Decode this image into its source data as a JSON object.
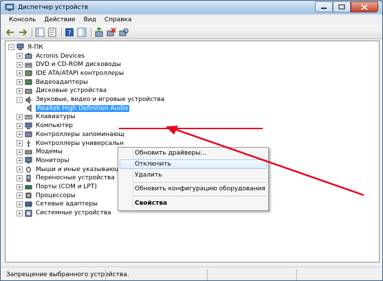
{
  "window": {
    "title": "Диспетчер устройств"
  },
  "menu": [
    "Консоль",
    "Действие",
    "Вид",
    "Справка"
  ],
  "toolbar_icons": [
    "back-icon",
    "forward-icon",
    "show-hide-tree-icon",
    "properties-icon",
    "help-icon",
    "action-pane-icon",
    "update-driver-icon",
    "uninstall-icon",
    "scan-hardware-icon"
  ],
  "tree": {
    "root": "Я-ПК",
    "items": [
      {
        "label": "Acronis Devices",
        "icon": "device-icon",
        "expander": "+"
      },
      {
        "label": "DVD и CD-ROM дисководы",
        "icon": "dvd-icon",
        "expander": "+"
      },
      {
        "label": "IDE ATA/ATAPI контроллеры",
        "icon": "ide-icon",
        "expander": "+"
      },
      {
        "label": "Видеоадаптеры",
        "icon": "display-icon",
        "expander": "+"
      },
      {
        "label": "Дисковые устройства",
        "icon": "disk-icon",
        "expander": "+"
      },
      {
        "label": "Звуковые, видео и игровые устройства",
        "icon": "sound-icon",
        "expander": "-"
      },
      {
        "label": "Realtek High Definition Audio",
        "icon": "speaker-icon",
        "expander": ""
      },
      {
        "label": "Клавиатуры",
        "icon": "keyboard-icon",
        "expander": "+"
      },
      {
        "label": "Компьютер",
        "icon": "computer-icon",
        "expander": "+"
      },
      {
        "label": "Контроллеры запоминающ",
        "icon": "storage-icon",
        "expander": "+"
      },
      {
        "label": "Контроллеры универсальн",
        "icon": "usb-icon",
        "expander": "+"
      },
      {
        "label": "Модемы",
        "icon": "modem-icon",
        "expander": "+"
      },
      {
        "label": "Мониторы",
        "icon": "monitor-icon",
        "expander": "+"
      },
      {
        "label": "Мыши и иные указывающие",
        "icon": "mouse-icon",
        "expander": "+"
      },
      {
        "label": "Переносные устройства",
        "icon": "portable-icon",
        "expander": "+"
      },
      {
        "label": "Порты (COM и LPT)",
        "icon": "port-icon",
        "expander": "+"
      },
      {
        "label": "Процессоры",
        "icon": "cpu-icon",
        "expander": "+"
      },
      {
        "label": "Сетевые адаптеры",
        "icon": "network-icon",
        "expander": "+"
      },
      {
        "label": "Системные устройства",
        "icon": "system-icon",
        "expander": "+"
      }
    ]
  },
  "context_menu": {
    "update": "Обновить драйверы...",
    "disable": "Отключить",
    "uninstall": "Удалить",
    "scan": "Обновить конфигурацию оборудования",
    "properties": "Свойства"
  },
  "status": "Запрещение выбранного устройства.",
  "colors": {
    "selection": "#3399ff",
    "annotation": "#e8001c"
  }
}
